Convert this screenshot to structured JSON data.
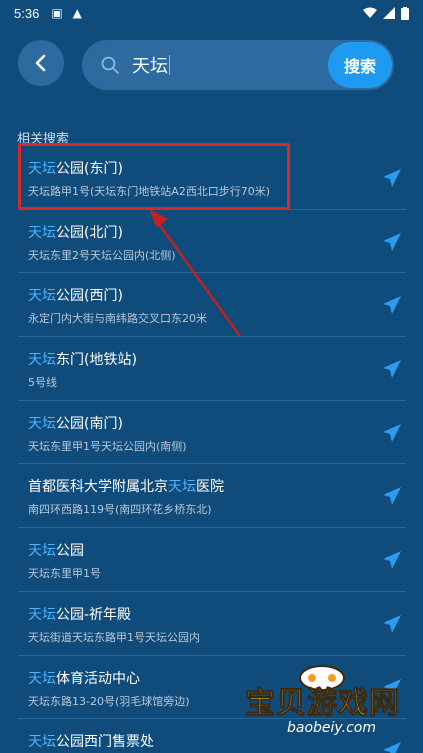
{
  "status_bar": {
    "time": "5:36"
  },
  "search": {
    "query": "天坛",
    "button_label": "搜索"
  },
  "section_title": "相关搜索",
  "results": [
    {
      "highlight": "天坛",
      "rest": "公园(东门)",
      "prefix": "",
      "sub": "天坛路甲1号(天坛东门地铁站A2西北口步行70米)"
    },
    {
      "highlight": "天坛",
      "rest": "公园(北门)",
      "prefix": "",
      "sub": "天坛东里2号天坛公园内(北侧)"
    },
    {
      "highlight": "天坛",
      "rest": "公园(西门)",
      "prefix": "",
      "sub": "永定门内大街与南纬路交叉口东20米"
    },
    {
      "highlight": "天坛",
      "rest": "东门(地铁站)",
      "prefix": "",
      "sub": "5号线"
    },
    {
      "highlight": "天坛",
      "rest": "公园(南门)",
      "prefix": "",
      "sub": "天坛东里甲1号天坛公园内(南侧)"
    },
    {
      "highlight": "天坛",
      "rest": "医院",
      "prefix": "首都医科大学附属北京",
      "sub": "南四环西路119号(南四环花乡桥东北)"
    },
    {
      "highlight": "天坛",
      "rest": "公园",
      "prefix": "",
      "sub": "天坛东里甲1号"
    },
    {
      "highlight": "天坛",
      "rest": "公园-祈年殿",
      "prefix": "",
      "sub": "天坛街道天坛东路甲1号天坛公园内"
    },
    {
      "highlight": "天坛",
      "rest": "体育活动中心",
      "prefix": "",
      "sub": "天坛东路13-20号(羽毛球馆旁边)"
    },
    {
      "highlight": "天坛",
      "rest": "公园西门售票处",
      "prefix": "",
      "sub": ""
    }
  ],
  "watermark": {
    "text": "宝贝游戏网",
    "domain": "baobeiy.com"
  },
  "colors": {
    "background": "#0f4c7c",
    "accent": "#1e9bf0",
    "highlight_text": "#4db2ff",
    "annotation": "#d42a2a"
  }
}
